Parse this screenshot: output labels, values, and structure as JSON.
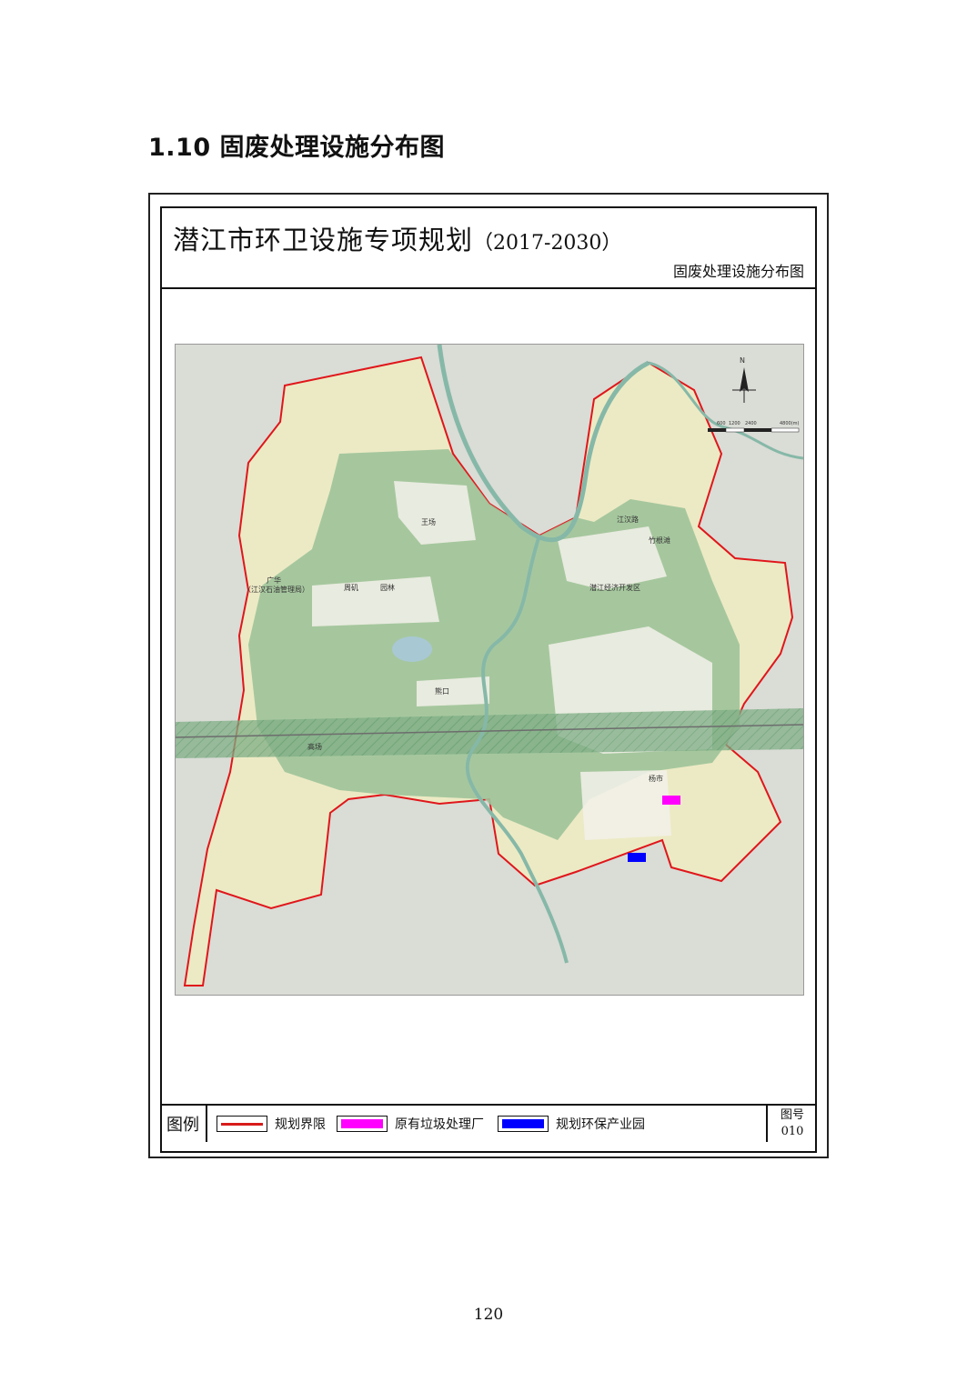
{
  "heading": {
    "number": "1.10",
    "text": "固废处理设施分布图"
  },
  "title_block": {
    "title": "潜江市环卫设施专项规划",
    "years": "（2017-2030）",
    "subtitle": "固废处理设施分布图"
  },
  "map": {
    "place_labels": [
      "王场",
      "竹根滩",
      "潜江经济开发区",
      "广华",
      "（江汉石油管理局）",
      "周矶",
      "园林",
      "熊口",
      "高场",
      "杨市",
      "江汉路"
    ],
    "scale_bar_labels": [
      "600",
      "1200",
      "2400",
      "4800(m)"
    ],
    "north_label": "N",
    "markers": [
      {
        "name": "原有垃圾处理厂",
        "color": "#ff00ff"
      },
      {
        "name": "规划环保产业园",
        "color": "#0000ff"
      }
    ],
    "colors": {
      "background": "#dadcd6",
      "planning_area": "#eceac4",
      "boundary": "#e0161b",
      "green_space": "#9fc39a",
      "river": "#86b8a8",
      "urban": "#f3f1ea"
    }
  },
  "legend": {
    "title": "图例",
    "items": [
      {
        "label": "规划界限",
        "kind": "line",
        "color": "#d81a1a"
      },
      {
        "label": "原有垃圾处理厂",
        "kind": "fill",
        "color": "#ff00ff"
      },
      {
        "label": "规划环保产业园",
        "kind": "fill",
        "color": "#0000ff"
      }
    ],
    "figure_number_label": "图号",
    "figure_number": "010"
  },
  "page_number": "120"
}
